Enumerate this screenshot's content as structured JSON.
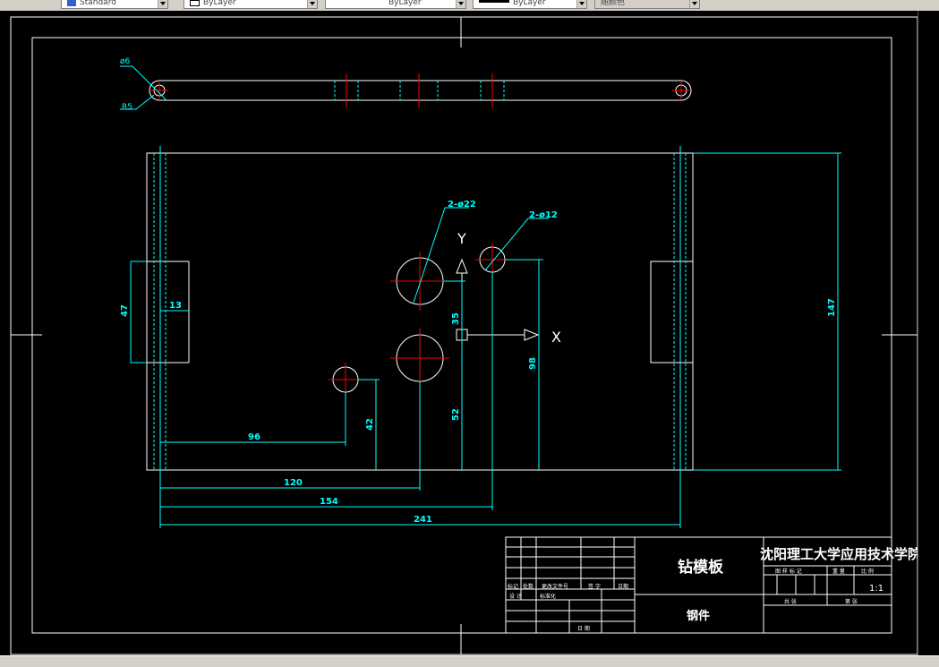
{
  "toolbar": {
    "text_style": "Standard",
    "layer_color": "ByLayer",
    "linetype": "ByLayer",
    "lineweight": "ByLayer",
    "plot_style": "随颜色"
  },
  "drawing": {
    "top_view": {
      "dia_label": "ø6",
      "rad_label": "R5"
    },
    "dimensions": {
      "hole_22": "2-ø22",
      "hole_12": "2-ø12",
      "d13": "13",
      "d47": "47",
      "d147": "147",
      "d96": "96",
      "d42": "42",
      "d52": "52",
      "d35": "35",
      "d98": "98",
      "d120": "120",
      "d154": "154",
      "d241": "241"
    },
    "ucs": {
      "x": "X",
      "y": "Y"
    }
  },
  "title_block": {
    "part_name": "钻模板",
    "material": "钢件",
    "school": "沈阳理工大学应用技术学院",
    "scale": "1:1",
    "labels": {
      "biaoji": "标记",
      "chushu": "处数",
      "change_doc": "更改文件号",
      "signature": "签 字",
      "date": "日期",
      "designer": "设 计",
      "standardize": "标准化",
      "date2": "日 期",
      "stage_mark": "图 样 标 记",
      "weight": "重 量",
      "ratio": "比 例",
      "total": "共 张",
      "sheet": "第 张"
    }
  },
  "colors": {
    "line": "#ffffff",
    "dim": "#00ffff",
    "center": "#ff0000",
    "background": "#000000"
  }
}
